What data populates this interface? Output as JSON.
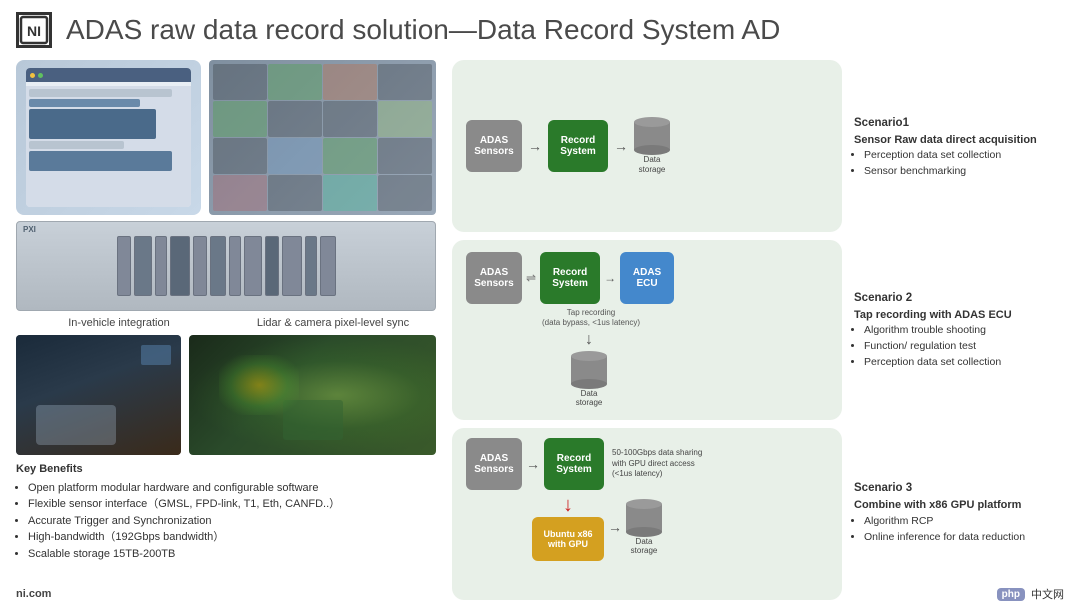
{
  "header": {
    "logo": "NI",
    "title": "ADAS raw data record solution—Data Record System AD"
  },
  "left": {
    "label1": "In-vehicle integration",
    "label2": "Lidar & camera pixel-level sync",
    "key_benefits": {
      "title": "Key Benefits",
      "items": [
        "Open platform modular hardware and configurable software",
        "Flexible sensor interface（GMSL, FPD-link, T1, Eth, CANFD..）",
        "Accurate Trigger and Synchronization",
        "High-bandwidth（192Gbps bandwidth）",
        "Scalable storage 15TB-200TB"
      ]
    }
  },
  "scenarios": [
    {
      "id": "s1",
      "nodes": {
        "adas_sensors": "ADAS\nSensors",
        "record_system": "Record\nSystem",
        "data_storage": "Data\nstorage"
      },
      "desc_title": "Scenario1",
      "desc_subtitle": "Sensor Raw data direct acquisition",
      "desc_items": [
        "Perception data set collection",
        "Sensor benchmarking"
      ]
    },
    {
      "id": "s2",
      "nodes": {
        "adas_sensors": "ADAS\nSensors",
        "record_system": "Record\nSystem",
        "adas_ecu": "ADAS\nECU",
        "data_storage": "Data\nstorage"
      },
      "tap_label": "Tap recording\n(data bypass, <1us latency)",
      "desc_title": "Scenario 2",
      "desc_subtitle": "Tap recording  with ADAS ECU",
      "desc_items": [
        "Algorithm trouble shooting",
        "Function/ regulation test",
        "Perception data set collection"
      ]
    },
    {
      "id": "s3",
      "nodes": {
        "adas_sensors": "ADAS\nSensors",
        "record_system": "Record\nSystem",
        "ubuntu_gpu": "Ubuntu x86\nwith GPU",
        "data_storage": "Data\nstorage"
      },
      "sharing_label": "50-100Gbps data sharing\nwith GPU direct access\n(<1us latency)",
      "desc_title": "Scenario 3",
      "desc_subtitle": "Combine with x86 GPU platform",
      "desc_items": [
        "Algorithm RCP",
        "Online inference for data reduction"
      ]
    }
  ],
  "footer": {
    "logo": "ni.com",
    "php_badge": "php",
    "chinese": "中文网"
  }
}
